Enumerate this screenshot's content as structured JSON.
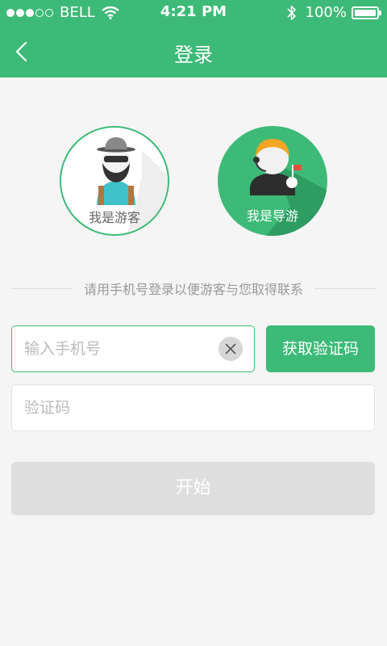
{
  "status_bar": {
    "carrier": "BELL",
    "time": "4:21 PM",
    "battery": "100%",
    "signal_bars": 3,
    "battery_level": 1.0,
    "icons": [
      "signal-dots-icon",
      "wifi-icon",
      "bluetooth-icon",
      "battery-icon"
    ]
  },
  "header": {
    "title": "登录",
    "back_icon": "chevron-left-icon"
  },
  "roles": {
    "tourist": {
      "label": "我是游客",
      "icon": "tourist-avatar-icon"
    },
    "guide": {
      "label": "我是导游",
      "icon": "guide-avatar-icon",
      "selected": true
    }
  },
  "hint": "请用手机号登录以便游客与您取得联系",
  "form": {
    "phone_placeholder": "输入手机号",
    "phone_value": "",
    "clear_icon": "close-icon",
    "get_code_label": "获取验证码",
    "code_placeholder": "验证码",
    "code_value": "",
    "start_label": "开始"
  },
  "colors": {
    "brand": "#3dba77",
    "background": "#f5f5f5",
    "disabled_button": "#dedede"
  }
}
